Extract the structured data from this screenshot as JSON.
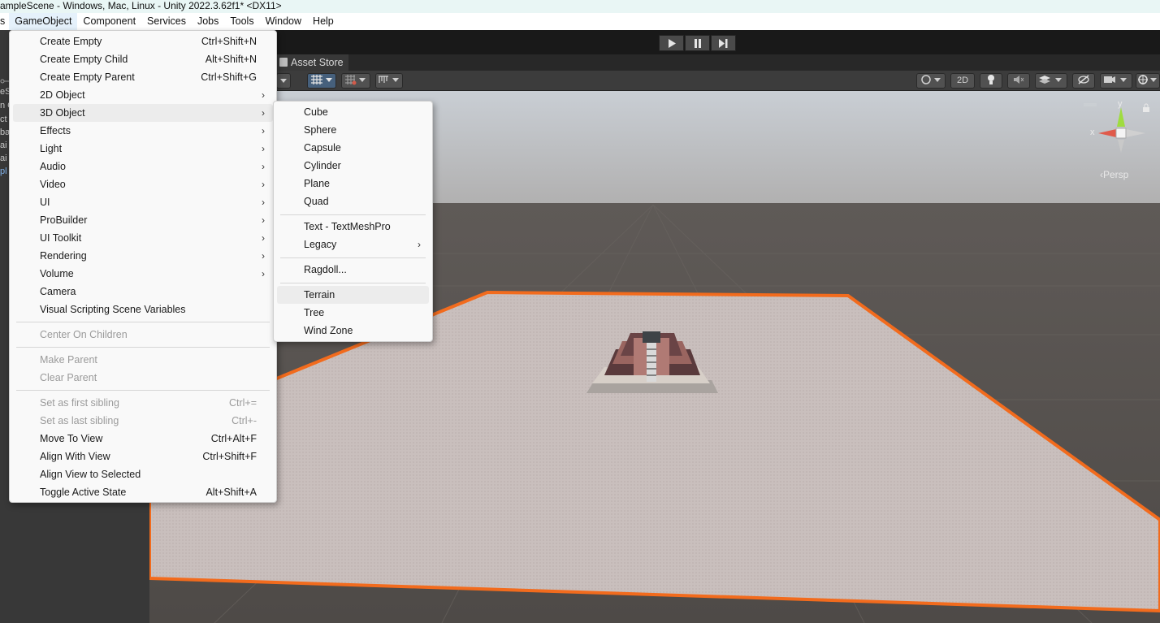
{
  "window": {
    "title": "ampleScene - Windows, Mac, Linux - Unity 2022.3.62f1* <DX11>"
  },
  "menubar": {
    "items": [
      "s",
      "GameObject",
      "Component",
      "Services",
      "Jobs",
      "Tools",
      "Window",
      "Help"
    ]
  },
  "scene": {
    "asset_store_tab": "Asset Store",
    "toolbar_2d": "2D",
    "persp_label": "‹Persp",
    "axis_x": "x",
    "axis_y": "y"
  },
  "hierarchy": {
    "fragments": [
      "eS",
      "n C",
      "ct",
      "bal",
      "ai",
      "ai",
      "pl"
    ]
  },
  "gameobject_menu": {
    "items": [
      {
        "label": "Create Empty",
        "shortcut": "Ctrl+Shift+N"
      },
      {
        "label": "Create Empty Child",
        "shortcut": "Alt+Shift+N"
      },
      {
        "label": "Create Empty Parent",
        "shortcut": "Ctrl+Shift+G"
      },
      {
        "label": "2D Object",
        "shortcut": ""
      },
      {
        "label": "3D Object",
        "shortcut": ""
      },
      {
        "label": "Effects",
        "shortcut": ""
      },
      {
        "label": "Light",
        "shortcut": ""
      },
      {
        "label": "Audio",
        "shortcut": ""
      },
      {
        "label": "Video",
        "shortcut": ""
      },
      {
        "label": "UI",
        "shortcut": ""
      },
      {
        "label": "ProBuilder",
        "shortcut": ""
      },
      {
        "label": "UI Toolkit",
        "shortcut": ""
      },
      {
        "label": "Rendering",
        "shortcut": ""
      },
      {
        "label": "Volume",
        "shortcut": ""
      },
      {
        "label": "Camera",
        "shortcut": ""
      },
      {
        "label": "Visual Scripting Scene Variables",
        "shortcut": ""
      },
      {
        "label": "Center On Children",
        "shortcut": ""
      },
      {
        "label": "Make Parent",
        "shortcut": ""
      },
      {
        "label": "Clear Parent",
        "shortcut": ""
      },
      {
        "label": "Set as first sibling",
        "shortcut": "Ctrl+="
      },
      {
        "label": "Set as last sibling",
        "shortcut": "Ctrl+-"
      },
      {
        "label": "Move To View",
        "shortcut": "Ctrl+Alt+F"
      },
      {
        "label": "Align With View",
        "shortcut": "Ctrl+Shift+F"
      },
      {
        "label": "Align View to Selected",
        "shortcut": ""
      },
      {
        "label": "Toggle Active State",
        "shortcut": "Alt+Shift+A"
      }
    ]
  },
  "object3d_menu": {
    "items": [
      {
        "label": "Cube"
      },
      {
        "label": "Sphere"
      },
      {
        "label": "Capsule"
      },
      {
        "label": "Cylinder"
      },
      {
        "label": "Plane"
      },
      {
        "label": "Quad"
      },
      {
        "label": "Text - TextMeshPro"
      },
      {
        "label": "Legacy"
      },
      {
        "label": "Ragdoll..."
      },
      {
        "label": "Terrain"
      },
      {
        "label": "Tree"
      },
      {
        "label": "Wind Zone"
      }
    ]
  },
  "colors": {
    "selection_outline": "#f26b1d",
    "terrain": "#c7bdbb",
    "ground": "#5b5652"
  }
}
